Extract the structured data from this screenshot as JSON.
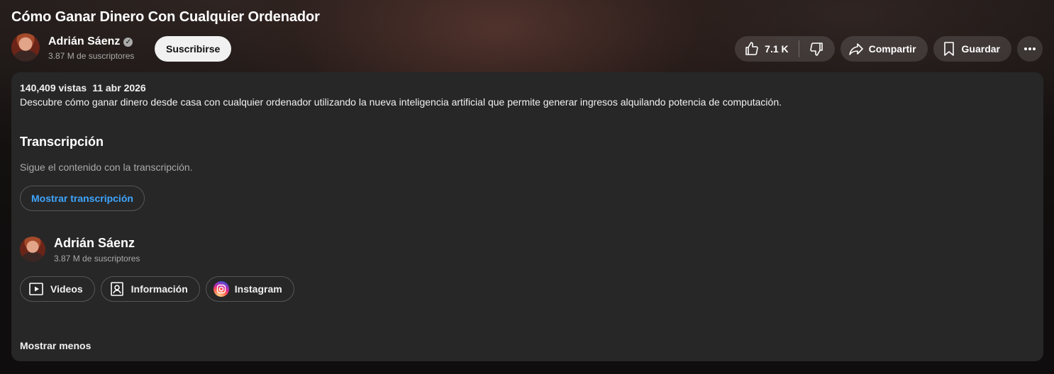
{
  "video": {
    "title": "Cómo Ganar Dinero Con Cualquier Ordenador"
  },
  "owner": {
    "name": "Adrián Sáenz",
    "verified": true,
    "subscribers": "3.87 M de suscriptores",
    "subscribe_label": "Suscribirse"
  },
  "actions": {
    "likes": "7.1 K",
    "share_label": "Compartir",
    "save_label": "Guardar"
  },
  "description": {
    "views": "140,409 vistas",
    "date": "11 abr 2026",
    "text": "Descubre cómo ganar dinero desde casa con cualquier ordenador utilizando la nueva inteligencia artificial que permite generar ingresos alquilando potencia de computación.",
    "transcript_heading": "Transcripción",
    "transcript_subtitle": "Sigue el contenido con la transcripción.",
    "show_transcript_label": "Mostrar transcripción",
    "channel_name": "Adrián Sáenz",
    "channel_subscribers": "3.87 M de suscriptores",
    "links": [
      {
        "label": "Videos",
        "icon": "play-square-icon"
      },
      {
        "label": "Información",
        "icon": "person-card-icon"
      },
      {
        "label": "Instagram",
        "icon": "instagram-icon"
      }
    ],
    "show_less_label": "Mostrar menos"
  },
  "colors": {
    "background": "#0f0f0f",
    "panel": "#272727",
    "link_blue": "#3ea6ff"
  }
}
